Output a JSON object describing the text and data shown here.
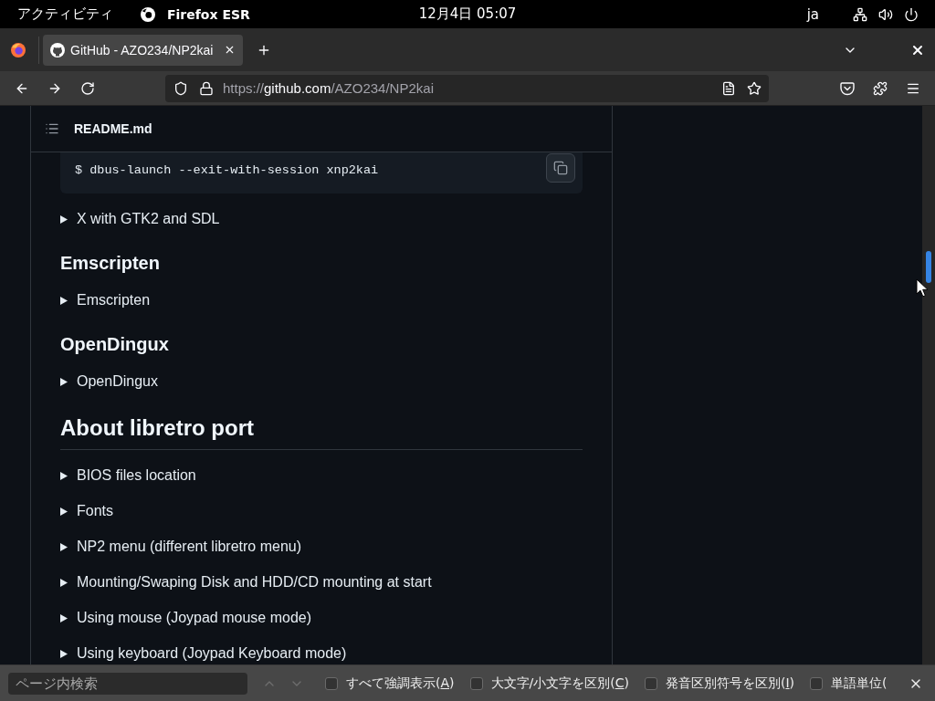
{
  "top_bar": {
    "activities": "アクティビティ",
    "app_name": "Firefox ESR",
    "clock": "12月4日 05:07",
    "input_method": "ja"
  },
  "tabs": [
    {
      "title": "GitHub - AZO234/NP2kai",
      "selected": true
    }
  ],
  "address_bar": {
    "scheme": "https://",
    "host": "github.com",
    "path": "/AZO234/NP2kai"
  },
  "readme": {
    "title": "README.md",
    "blocks": [
      {
        "kind": "code",
        "text": "$ dbus-launch --exit-with-session xnp2kai"
      },
      {
        "kind": "details",
        "summary": "X with GTK2 and SDL",
        "expanded": false
      },
      {
        "kind": "heading3",
        "text": "Emscripten"
      },
      {
        "kind": "details",
        "summary": "Emscripten",
        "expanded": false
      },
      {
        "kind": "heading3",
        "text": "OpenDingux"
      },
      {
        "kind": "details",
        "summary": "OpenDingux",
        "expanded": false
      },
      {
        "kind": "heading2",
        "text": "About libretro port"
      },
      {
        "kind": "details",
        "summary": "BIOS files location",
        "expanded": false
      },
      {
        "kind": "details",
        "summary": "Fonts",
        "expanded": false
      },
      {
        "kind": "details",
        "summary": "NP2 menu (different libretro menu)",
        "expanded": false
      },
      {
        "kind": "details",
        "summary": "Mounting/Swaping Disk and HDD/CD mounting at start",
        "expanded": false
      },
      {
        "kind": "details",
        "summary": "Using mouse (Joypad mouse mode)",
        "expanded": false
      },
      {
        "kind": "details",
        "summary": "Using keyboard (Joypad Keyboard mode)",
        "expanded": false
      }
    ]
  },
  "find_bar": {
    "placeholder": "ページ内検索",
    "nav_buttons": [
      {
        "kind": "previous",
        "disabled": true
      },
      {
        "kind": "next",
        "disabled": true
      }
    ],
    "options": [
      {
        "label": "すべて強調表示(",
        "accesskey": "A",
        "label_end": ")",
        "checked": false
      },
      {
        "label": "大文字/小文字を区別(",
        "accesskey": "C",
        "label_end": ")",
        "checked": false
      },
      {
        "label": "発音区別符号を区別(",
        "accesskey": "I",
        "label_end": ")",
        "checked": false
      },
      {
        "label": "単語単位(",
        "checked": false
      }
    ]
  }
}
